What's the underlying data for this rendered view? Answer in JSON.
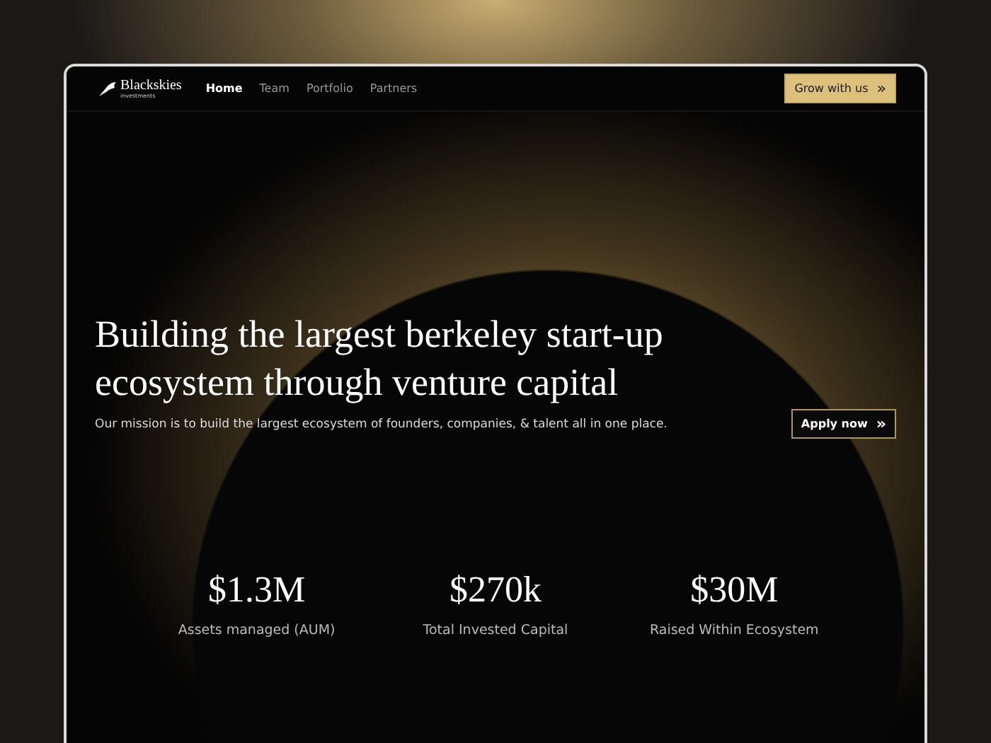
{
  "brand": {
    "name": "Blackskies",
    "tagline": "investments"
  },
  "nav": [
    {
      "label": "Home",
      "selected": true
    },
    {
      "label": "Team",
      "selected": false
    },
    {
      "label": "Portfolio",
      "selected": false
    },
    {
      "label": "Partners",
      "selected": false
    }
  ],
  "cta": {
    "label": "Grow with us",
    "icon": "»"
  },
  "hero": {
    "heading": "Building the largest berkeley start-up ecosystem through venture capital",
    "subtitle": "Our mission is to build the largest ecosystem of founders, companies, & talent all in one place.",
    "button": "Apply now",
    "button_icon": "»"
  },
  "stats": [
    {
      "value": "$1.3M",
      "label": "Assets managed (AUM)"
    },
    {
      "value": "$270k",
      "label": "Total Invested Capital"
    },
    {
      "value": "$30M",
      "label": "Raised Within Ecosystem"
    }
  ]
}
